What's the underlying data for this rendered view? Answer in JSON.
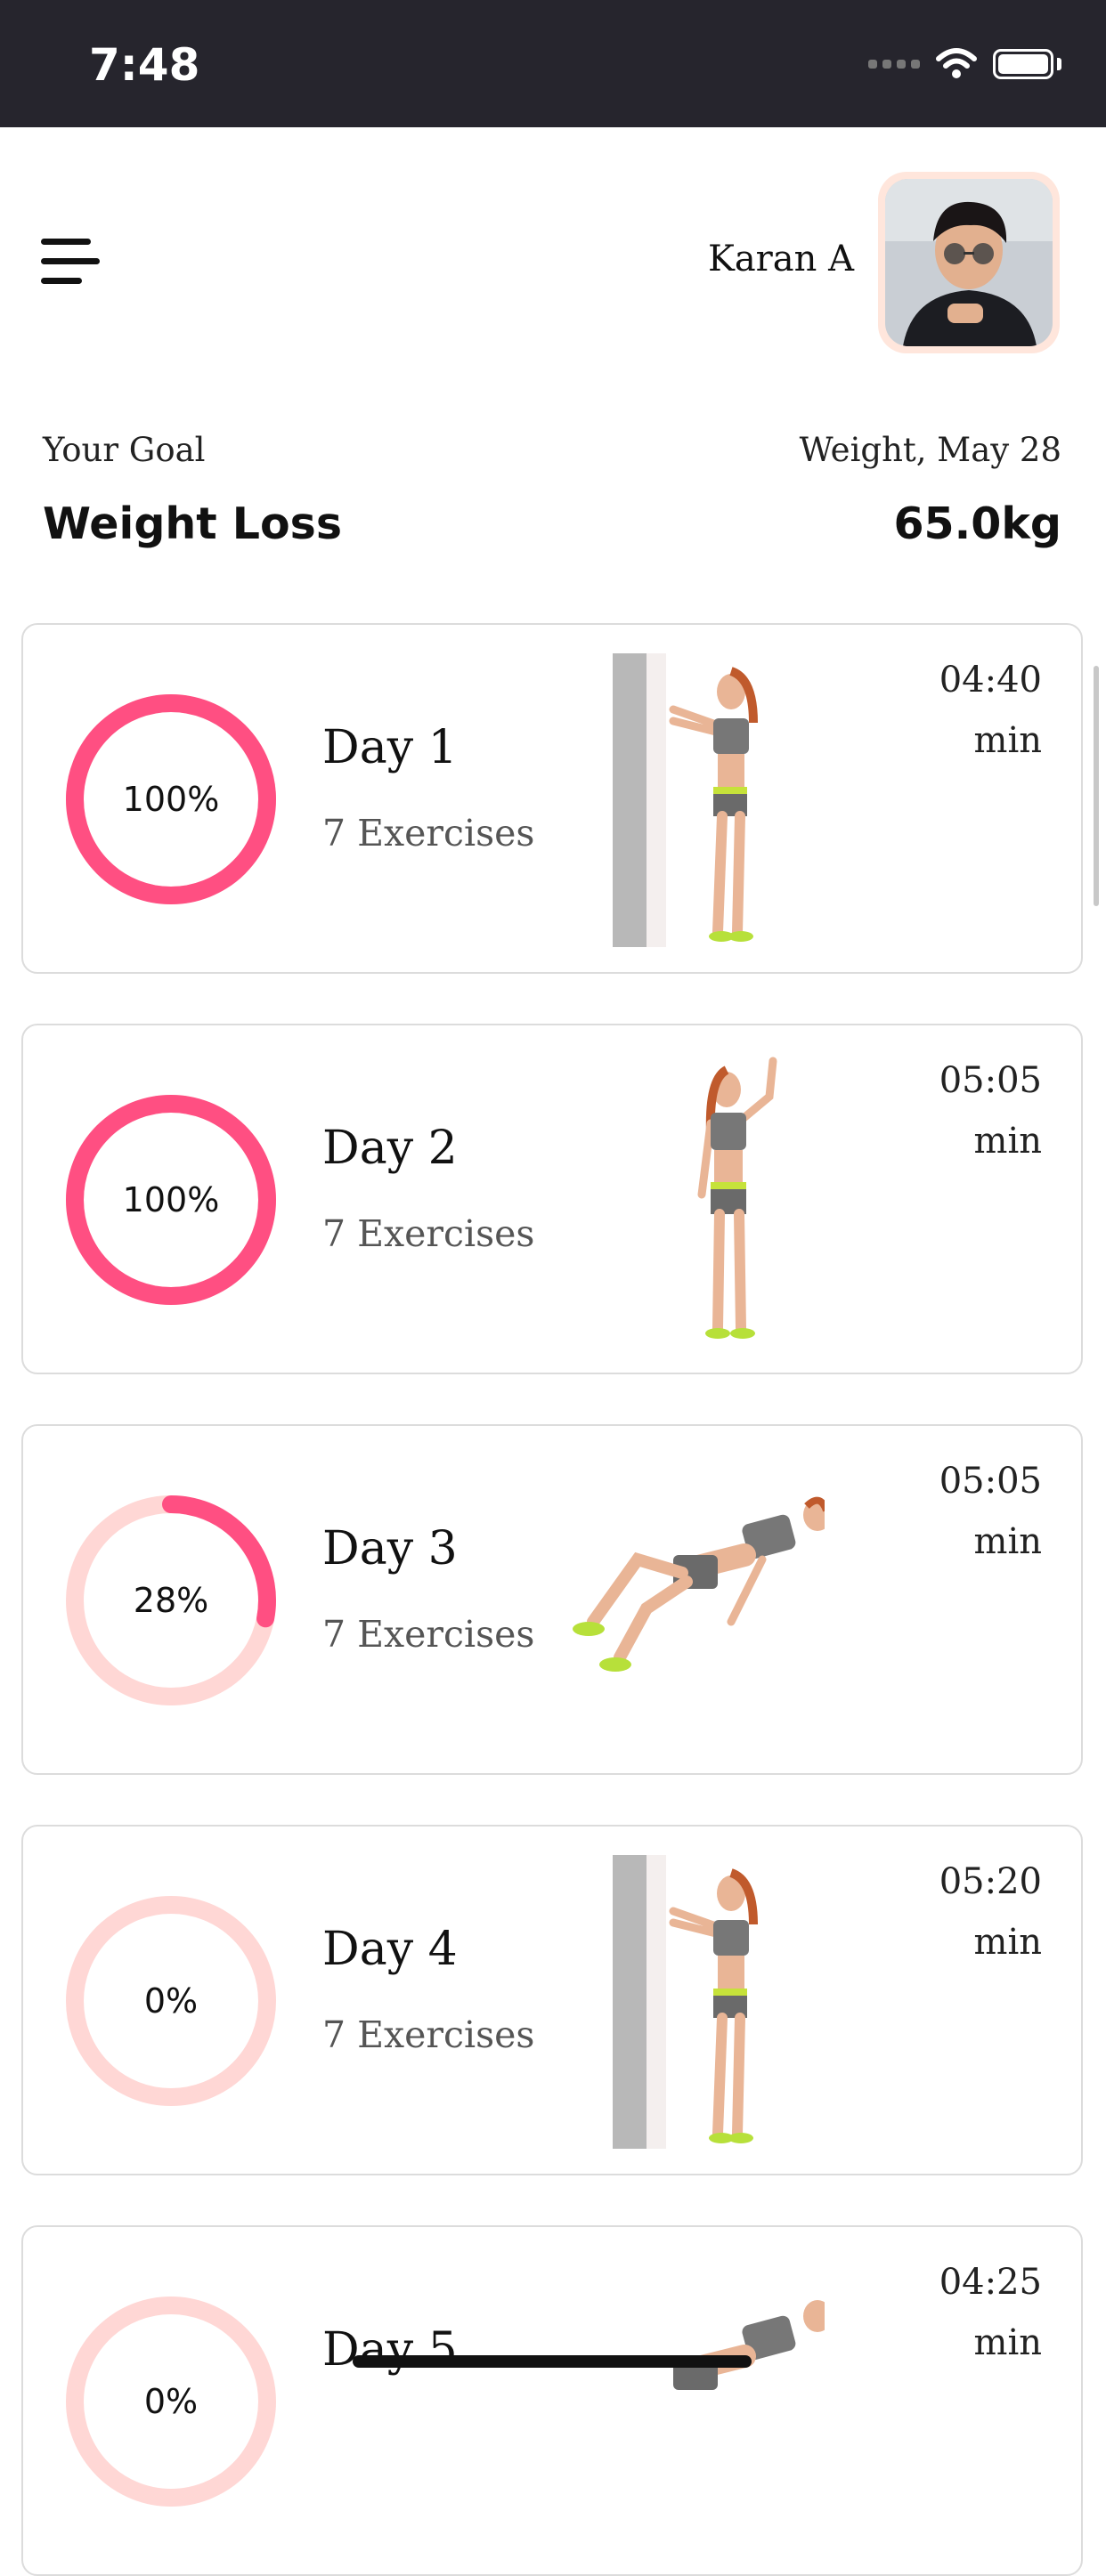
{
  "status": {
    "time": "7:48"
  },
  "header": {
    "user_name": "Karan A"
  },
  "goal": {
    "label": "Your Goal",
    "value": "Weight Loss"
  },
  "weight": {
    "label": "Weight, May 28",
    "value": "65.0kg"
  },
  "colors": {
    "progress": "#ff4f82",
    "track": "#ffd7d5",
    "card_border": "#dcdcdc"
  },
  "days": [
    {
      "title": "Day 1",
      "subtitle": "7 Exercises",
      "progress": 100,
      "progress_label": "100%",
      "duration": "04:40",
      "unit": "min",
      "illustration": "wall-push-up"
    },
    {
      "title": "Day 2",
      "subtitle": "7 Exercises",
      "progress": 100,
      "progress_label": "100%",
      "duration": "05:05",
      "unit": "min",
      "illustration": "arm-raise"
    },
    {
      "title": "Day 3",
      "subtitle": "7 Exercises",
      "progress": 28,
      "progress_label": "28%",
      "duration": "05:05",
      "unit": "min",
      "illustration": "floor-exercise"
    },
    {
      "title": "Day 4",
      "subtitle": "7 Exercises",
      "progress": 0,
      "progress_label": "0%",
      "duration": "05:20",
      "unit": "min",
      "illustration": "wall-push-up"
    },
    {
      "title": "Day 5",
      "subtitle": "",
      "progress": 0,
      "progress_label": "0%",
      "duration": "04:25",
      "unit": "min",
      "illustration": "floor-exercise"
    }
  ]
}
